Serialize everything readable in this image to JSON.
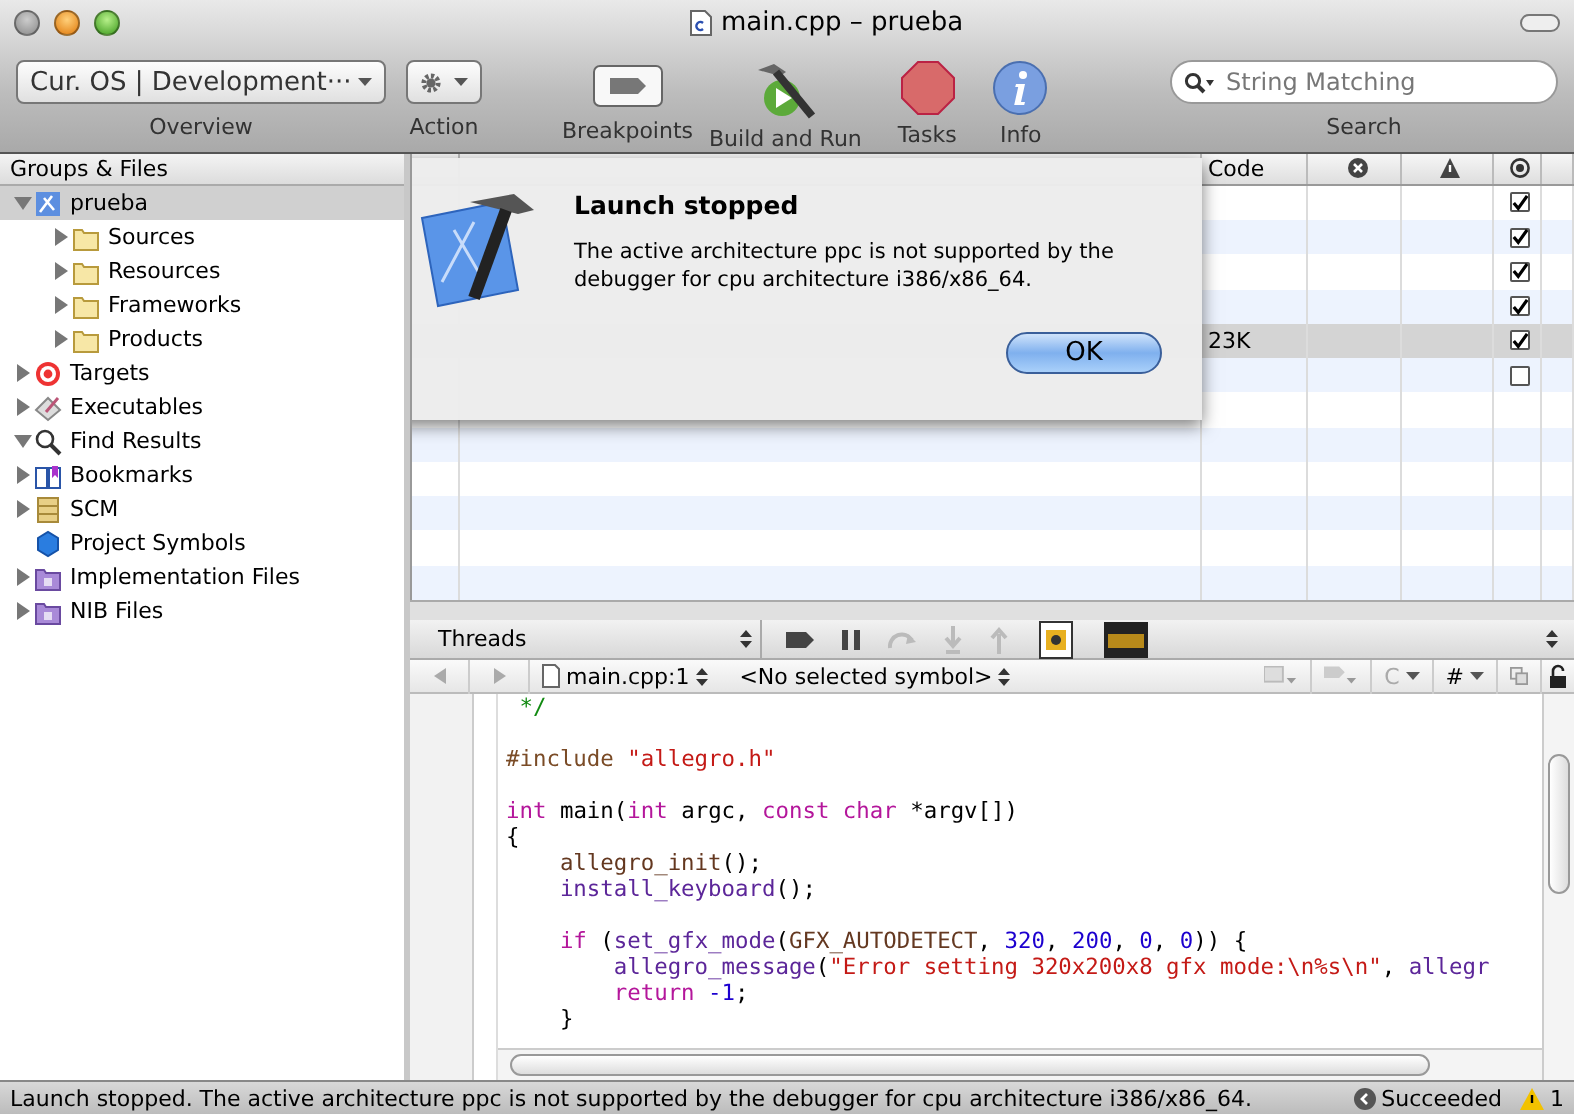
{
  "window": {
    "title": "main.cpp – prueba"
  },
  "toolbar": {
    "overview": {
      "value": "Cur. OS | Development···",
      "label": "Overview"
    },
    "action": {
      "label": "Action"
    },
    "buttons": [
      {
        "kind": "breakpoints",
        "label": "Breakpoints"
      },
      {
        "kind": "build",
        "label": "Build and Run"
      },
      {
        "kind": "tasks",
        "label": "Tasks"
      },
      {
        "kind": "info",
        "label": "Info"
      }
    ],
    "search": {
      "placeholder": "String Matching",
      "label": "Search"
    }
  },
  "sidebar": {
    "title": "Groups & Files",
    "items": [
      {
        "kind": "project",
        "label": "prueba",
        "selected": true,
        "expanded": true,
        "children": [
          {
            "kind": "folder",
            "label": "Sources",
            "selected": false,
            "expanded": false
          },
          {
            "kind": "folder",
            "label": "Resources",
            "selected": false,
            "expanded": false
          },
          {
            "kind": "folder",
            "label": "Frameworks",
            "selected": false,
            "expanded": false
          },
          {
            "kind": "folder",
            "label": "Products",
            "selected": false,
            "expanded": false
          }
        ]
      },
      {
        "kind": "target",
        "label": "Targets",
        "selected": false,
        "expanded": false
      },
      {
        "kind": "executable",
        "label": "Executables",
        "selected": false,
        "expanded": false
      },
      {
        "kind": "search",
        "label": "Find Results",
        "selected": false,
        "expanded": true
      },
      {
        "kind": "bookmark",
        "label": "Bookmarks",
        "selected": false,
        "expanded": false
      },
      {
        "kind": "scm",
        "label": "SCM",
        "selected": false,
        "expanded": false
      },
      {
        "kind": "symbols",
        "label": "Project Symbols",
        "selected": false
      },
      {
        "kind": "smart",
        "label": "Implementation Files",
        "selected": false,
        "expanded": false
      },
      {
        "kind": "smart",
        "label": "NIB Files",
        "selected": false,
        "expanded": false
      }
    ]
  },
  "table": {
    "columns": [
      {
        "kind": "text",
        "label": "Code"
      },
      {
        "kind": "errors"
      },
      {
        "kind": "warnings"
      },
      {
        "kind": "target"
      }
    ],
    "rows": [
      {
        "selected": false,
        "checked": true
      },
      {
        "selected": false,
        "checked": true
      },
      {
        "selected": false,
        "checked": true
      },
      {
        "selected": false,
        "checked": true
      },
      {
        "selected": true,
        "checked": true,
        "code": "23K"
      },
      {
        "selected": false,
        "checked": false
      }
    ]
  },
  "dialog": {
    "title": "Launch stopped",
    "message": "The active architecture ppc is not supported by the debugger for cpu architecture i386/x86_64.",
    "button": "OK"
  },
  "debugger": {
    "threads": "Threads"
  },
  "editor": {
    "file": "main.cpp:1",
    "symbol": "<No selected symbol>",
    "menus": [
      "C",
      "#"
    ],
    "lines": [
      {
        "kind": "code",
        "tokens": [
          {
            "kind": "comment",
            "text": " */"
          }
        ]
      },
      {
        "kind": "blank"
      },
      {
        "kind": "code",
        "tokens": [
          {
            "kind": "preprocessor",
            "text": "#include "
          },
          {
            "kind": "string",
            "text": "\"allegro.h\""
          }
        ]
      },
      {
        "kind": "blank"
      },
      {
        "kind": "code",
        "tokens": [
          {
            "kind": "keyword",
            "text": "int"
          },
          {
            "kind": "plain",
            "text": " main("
          },
          {
            "kind": "keyword",
            "text": "int"
          },
          {
            "kind": "plain",
            "text": " argc, "
          },
          {
            "kind": "keyword",
            "text": "const char"
          },
          {
            "kind": "plain",
            "text": " *argv[])"
          }
        ]
      },
      {
        "kind": "code",
        "tokens": [
          {
            "kind": "plain",
            "text": "{"
          }
        ]
      },
      {
        "kind": "code",
        "tokens": [
          {
            "kind": "macro",
            "text": "    allegro_init"
          },
          {
            "kind": "plain",
            "text": "();"
          }
        ]
      },
      {
        "kind": "code",
        "tokens": [
          {
            "kind": "function",
            "text": "    install_keyboard"
          },
          {
            "kind": "plain",
            "text": "();"
          }
        ]
      },
      {
        "kind": "blank"
      },
      {
        "kind": "code",
        "tokens": [
          {
            "kind": "keyword",
            "text": "    if"
          },
          {
            "kind": "plain",
            "text": " ("
          },
          {
            "kind": "function",
            "text": "set_gfx_mode"
          },
          {
            "kind": "plain",
            "text": "("
          },
          {
            "kind": "macro",
            "text": "GFX_AUTODETECT"
          },
          {
            "kind": "plain",
            "text": ", "
          },
          {
            "kind": "number",
            "text": "320"
          },
          {
            "kind": "plain",
            "text": ", "
          },
          {
            "kind": "number",
            "text": "200"
          },
          {
            "kind": "plain",
            "text": ", "
          },
          {
            "kind": "number",
            "text": "0"
          },
          {
            "kind": "plain",
            "text": ", "
          },
          {
            "kind": "number",
            "text": "0"
          },
          {
            "kind": "plain",
            "text": ")) {"
          }
        ]
      },
      {
        "kind": "code",
        "tokens": [
          {
            "kind": "function",
            "text": "        allegro_message"
          },
          {
            "kind": "plain",
            "text": "("
          },
          {
            "kind": "string",
            "text": "\"Error setting 320x200x8 gfx mode:\\n%s\\n\""
          },
          {
            "kind": "plain",
            "text": ", "
          },
          {
            "kind": "function",
            "text": "allegr"
          }
        ]
      },
      {
        "kind": "code",
        "tokens": [
          {
            "kind": "keyword",
            "text": "        return"
          },
          {
            "kind": "number",
            "text": " -1"
          },
          {
            "kind": "plain",
            "text": ";"
          }
        ]
      },
      {
        "kind": "code",
        "tokens": [
          {
            "kind": "plain",
            "text": "    }"
          }
        ]
      }
    ]
  },
  "status_bar": {
    "message": "Launch stopped. The active architecture ppc is not supported by the debugger for cpu architecture i386/x86_64.",
    "result": "Succeeded",
    "warnings": "1"
  }
}
